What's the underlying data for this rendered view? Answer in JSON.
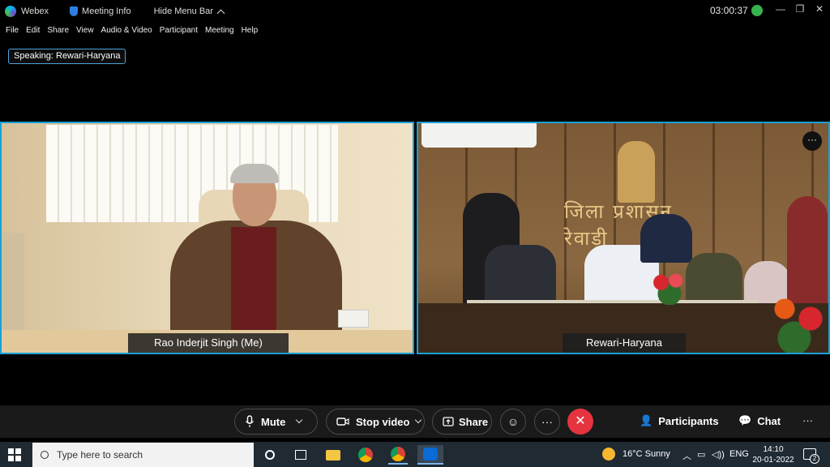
{
  "titlebar": {
    "app_name": "Webex",
    "meeting_info": "Meeting Info",
    "hide_menu": "Hide Menu Bar",
    "timer": "03:00:37"
  },
  "menu": [
    "File",
    "Edit",
    "Share",
    "View",
    "Audio & Video",
    "Participant",
    "Meeting",
    "Help"
  ],
  "speaking": {
    "label": "Speaking:",
    "name": "Rewari-Haryana"
  },
  "tiles": {
    "left_name": "Rao Inderjit Singh  (Me)",
    "right_name": "Rewari-Haryana",
    "right_more": "···",
    "right_banner": "जिला प्रशासन रेवाड़ी"
  },
  "controls": {
    "mute": "Mute",
    "stop_video": "Stop video",
    "share": "Share",
    "more": "···",
    "end": "✕",
    "participants": "Participants",
    "chat": "Chat",
    "overflow": "···"
  },
  "taskbar": {
    "search_placeholder": "Type here to search",
    "weather": "16°C  Sunny",
    "lang": "ENG",
    "time": "14:10",
    "date": "20-01-2022",
    "notifications": "2"
  },
  "colors": {
    "accent_border": "#19a0d8",
    "end_call": "#e5343f",
    "taskbar_bg": "#1f2a33"
  }
}
